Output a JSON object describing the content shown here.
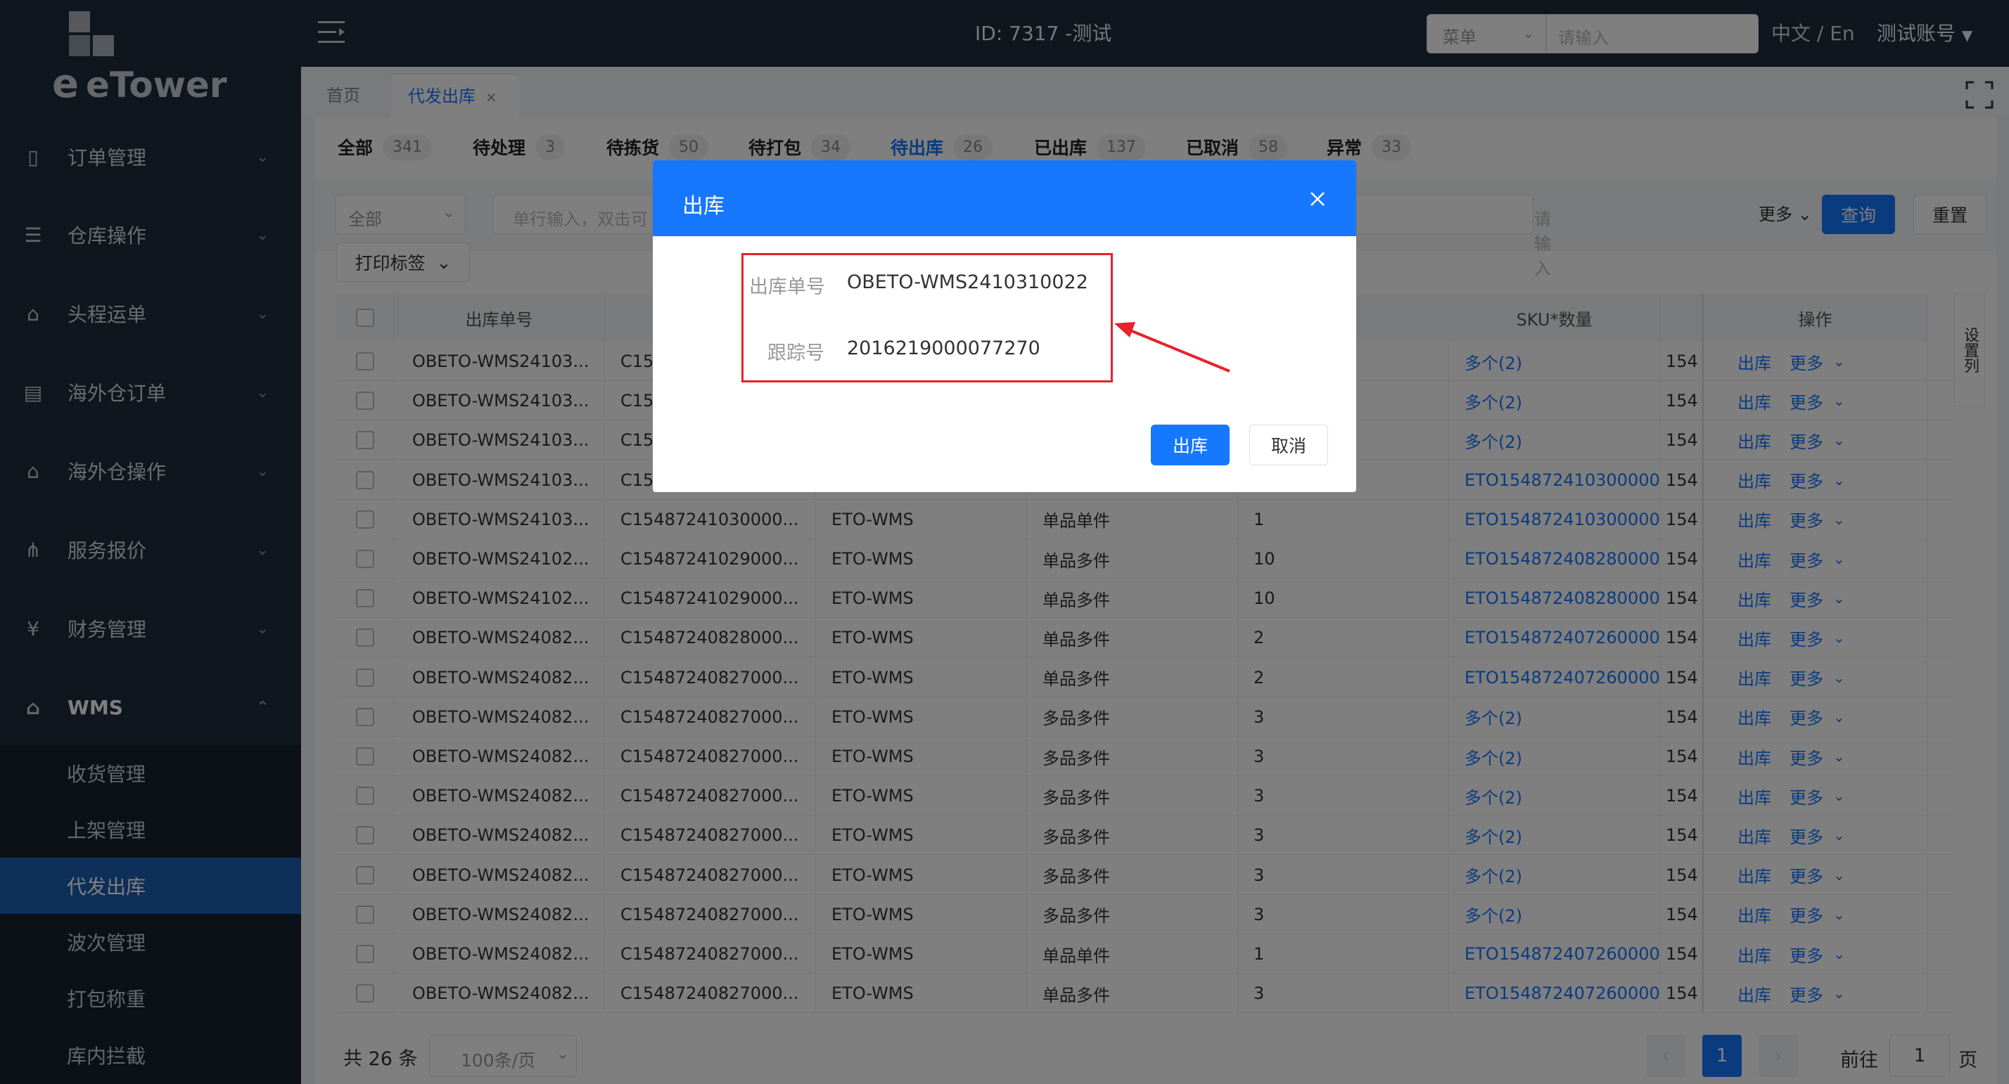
{
  "sidebar": {
    "logo_text": "eTower",
    "menu": [
      {
        "label": "订单管理",
        "icon": "document-icon"
      },
      {
        "label": "仓库操作",
        "icon": "warehouse-icon"
      },
      {
        "label": "头程运单",
        "icon": "truck-icon"
      },
      {
        "label": "海外仓订单",
        "icon": "list-icon"
      },
      {
        "label": "海外仓操作",
        "icon": "house-icon"
      },
      {
        "label": "服务报价",
        "icon": "network-icon"
      },
      {
        "label": "财务管理",
        "icon": "yen-icon"
      },
      {
        "label": "WMS",
        "icon": "home-icon"
      }
    ],
    "submenu": [
      "收货管理",
      "上架管理",
      "代发出库",
      "波次管理",
      "打包称重",
      "库内拦截"
    ],
    "active_submenu": "代发出库"
  },
  "topbar": {
    "id_text": "ID: 7317 -测试",
    "menu_select": "菜单",
    "search_placeholder": "请输入",
    "lang": "中文 / En",
    "user": "测试账号"
  },
  "tabs": {
    "home": "首页",
    "active": "代发出库"
  },
  "status_tabs": [
    {
      "label": "全部",
      "count": "341"
    },
    {
      "label": "待处理",
      "count": "3"
    },
    {
      "label": "待拣货",
      "count": "50"
    },
    {
      "label": "待打包",
      "count": "34"
    },
    {
      "label": "待出库",
      "count": "26"
    },
    {
      "label": "已出库",
      "count": "137"
    },
    {
      "label": "已取消",
      "count": "58"
    },
    {
      "label": "异常",
      "count": "33"
    }
  ],
  "filter": {
    "all_select": "全部",
    "order_placeholder": "单行输入，双击可",
    "input_placeholder": "请输入",
    "more": "更多",
    "query": "查询",
    "reset": "重置",
    "print_label": "打印标签"
  },
  "table": {
    "headers": {
      "col1": "出库单号",
      "col_sku": "SKU*数量",
      "col_qty": "量",
      "col_ops": "操作",
      "settings": "设置列"
    },
    "op_outbound": "出库",
    "op_more": "更多",
    "rows": [
      {
        "no": "OBETO-WMS24103...",
        "c2": "C15",
        "c3": "",
        "c4": "",
        "c5": "",
        "sku": "多个(2)",
        "c7": "154"
      },
      {
        "no": "OBETO-WMS24103...",
        "c2": "C15",
        "c3": "",
        "c4": "",
        "c5": "",
        "sku": "多个(2)",
        "c7": "154"
      },
      {
        "no": "OBETO-WMS24103...",
        "c2": "C15",
        "c3": "",
        "c4": "",
        "c5": "",
        "sku": "多个(2)",
        "c7": "154"
      },
      {
        "no": "OBETO-WMS24103...",
        "c2": "C15",
        "c3": "",
        "c4": "",
        "c5": "",
        "sku": "ETO154872410300000",
        "c7": "154"
      },
      {
        "no": "OBETO-WMS24103...",
        "c2": "C15487241030000...",
        "c3": "ETO-WMS",
        "c4": "单品单件",
        "c5": "1",
        "sku": "ETO154872410300000",
        "c7": "154"
      },
      {
        "no": "OBETO-WMS24102...",
        "c2": "C15487241029000...",
        "c3": "ETO-WMS",
        "c4": "单品多件",
        "c5": "10",
        "sku": "ETO154872408280000",
        "c7": "154"
      },
      {
        "no": "OBETO-WMS24102...",
        "c2": "C15487241029000...",
        "c3": "ETO-WMS",
        "c4": "单品多件",
        "c5": "10",
        "sku": "ETO154872408280000",
        "c7": "154"
      },
      {
        "no": "OBETO-WMS24082...",
        "c2": "C15487240828000...",
        "c3": "ETO-WMS",
        "c4": "单品多件",
        "c5": "2",
        "sku": "ETO154872407260000",
        "c7": "154"
      },
      {
        "no": "OBETO-WMS24082...",
        "c2": "C15487240827000...",
        "c3": "ETO-WMS",
        "c4": "单品多件",
        "c5": "2",
        "sku": "ETO154872407260000",
        "c7": "154"
      },
      {
        "no": "OBETO-WMS24082...",
        "c2": "C15487240827000...",
        "c3": "ETO-WMS",
        "c4": "多品多件",
        "c5": "3",
        "sku": "多个(2)",
        "c7": "154"
      },
      {
        "no": "OBETO-WMS24082...",
        "c2": "C15487240827000...",
        "c3": "ETO-WMS",
        "c4": "多品多件",
        "c5": "3",
        "sku": "多个(2)",
        "c7": "154"
      },
      {
        "no": "OBETO-WMS24082...",
        "c2": "C15487240827000...",
        "c3": "ETO-WMS",
        "c4": "多品多件",
        "c5": "3",
        "sku": "多个(2)",
        "c7": "154"
      },
      {
        "no": "OBETO-WMS24082...",
        "c2": "C15487240827000...",
        "c3": "ETO-WMS",
        "c4": "多品多件",
        "c5": "3",
        "sku": "多个(2)",
        "c7": "154"
      },
      {
        "no": "OBETO-WMS24082...",
        "c2": "C15487240827000...",
        "c3": "ETO-WMS",
        "c4": "多品多件",
        "c5": "3",
        "sku": "多个(2)",
        "c7": "154"
      },
      {
        "no": "OBETO-WMS24082...",
        "c2": "C15487240827000...",
        "c3": "ETO-WMS",
        "c4": "多品多件",
        "c5": "3",
        "sku": "多个(2)",
        "c7": "154"
      },
      {
        "no": "OBETO-WMS24082...",
        "c2": "C15487240827000...",
        "c3": "ETO-WMS",
        "c4": "单品单件",
        "c5": "1",
        "sku": "ETO154872407260000",
        "c7": "154"
      },
      {
        "no": "OBETO-WMS24082...",
        "c2": "C15487240827000...",
        "c3": "ETO-WMS",
        "c4": "单品多件",
        "c5": "3",
        "sku": "ETO154872407260000",
        "c7": "154"
      }
    ]
  },
  "pagination": {
    "total": "共 26 条",
    "page_size": "100条/页",
    "current": "1",
    "goto_label": "前往",
    "goto_value": "1",
    "page_suffix": "页"
  },
  "modal": {
    "title": "出库",
    "order_label": "出库单号",
    "order_value": "OBETO-WMS2410310022",
    "tracking_label": "跟踪号",
    "tracking_value": "2016219000077270",
    "confirm": "出库",
    "cancel": "取消"
  },
  "colors": {
    "primary": "#1677ff",
    "sidebar": "#1f2d3d",
    "highlight": "#e8212a"
  }
}
